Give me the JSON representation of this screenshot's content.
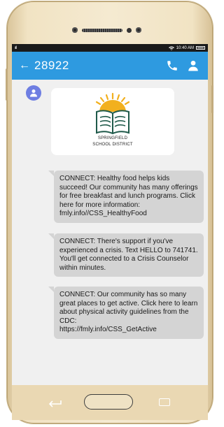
{
  "status_bar": {
    "signal": "ııll",
    "time": "10:40 AM"
  },
  "app_bar": {
    "back_label": "←",
    "title": "28922",
    "call_icon": "phone-icon",
    "contact_icon": "person-icon"
  },
  "logo": {
    "line1": "SPRINGFIELD",
    "line2": "SCHOOL DISTRICT"
  },
  "messages": [
    {
      "text": "CONNECT: Healthy food helps kids succeed! Our community has many offerings for free breakfast and lunch programs. Click here for more information:\nfmly.info//CSS_HealthyFood"
    },
    {
      "text": "CONNECT: There's support if you've experienced a crisis. Text HELLO to 741741. You'll get connected to a Crisis Counselor within minutes."
    },
    {
      "text": "CONNECT: Our community has so many great places to get active. Click here to learn about physical activity guidelines from the CDC:\nhttps://fmly.info/CSS_GetActive"
    }
  ],
  "colors": {
    "app_bar": "#2e9ae0",
    "avatar": "#6e7ee2",
    "bubble": "#d4d4d4",
    "phone_body": "#f1e3c3"
  }
}
